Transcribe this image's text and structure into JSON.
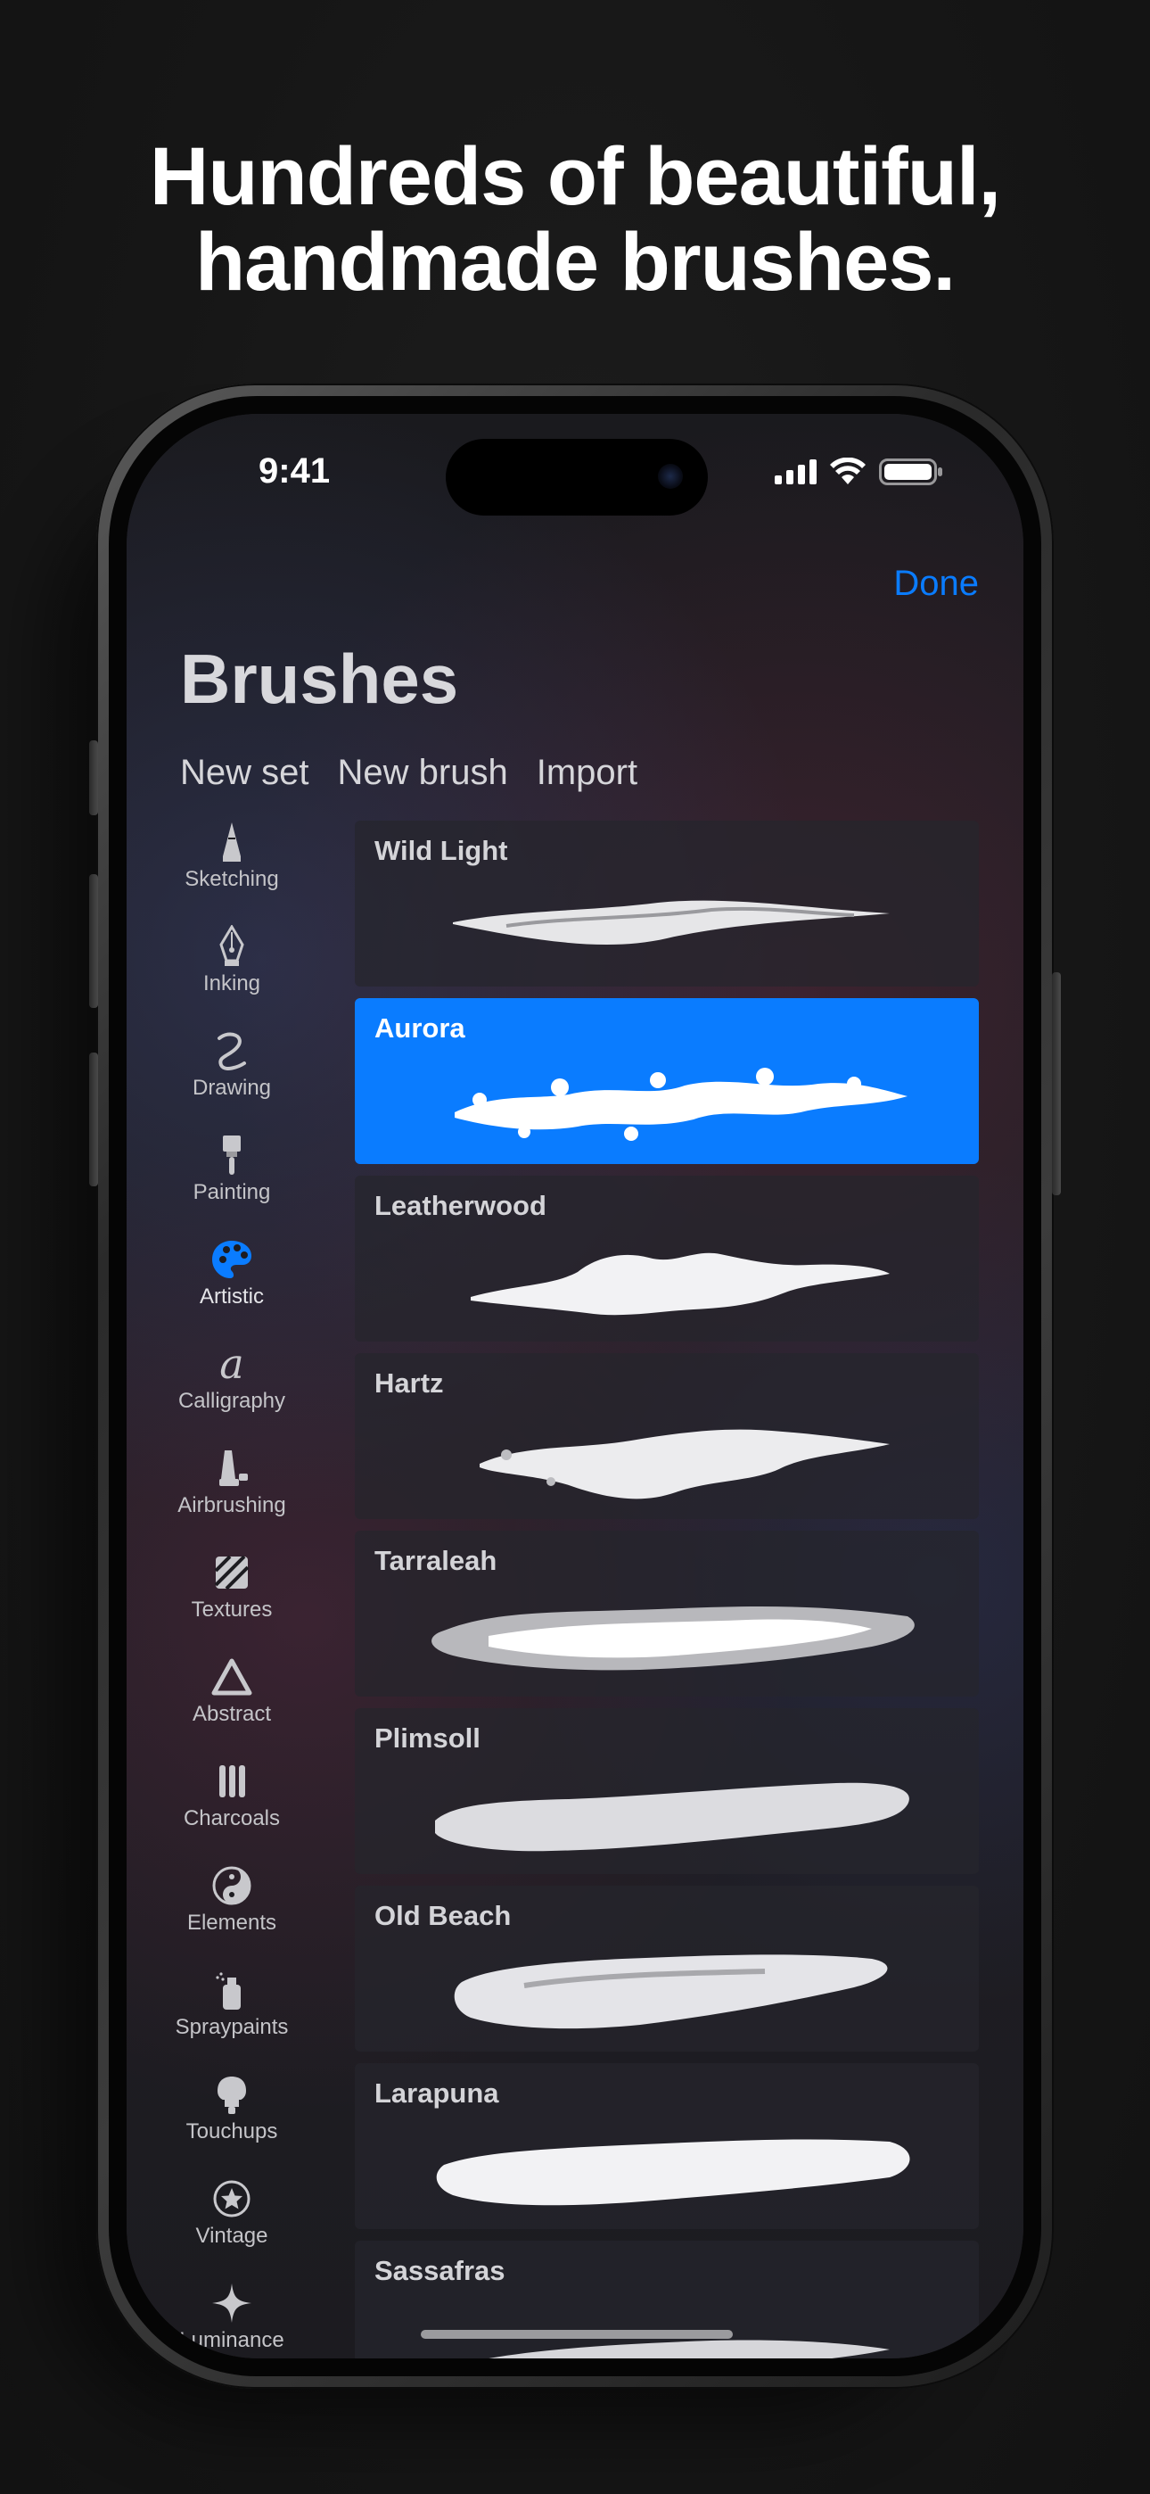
{
  "headline": {
    "line1": "Hundreds of beautiful,",
    "line2": "handmade brushes."
  },
  "status_bar": {
    "time": "9:41",
    "icons": [
      "cellular-signal-icon",
      "wifi-icon",
      "battery-icon"
    ]
  },
  "header": {
    "done_label": "Done",
    "title": "Brushes",
    "actions": [
      "New set",
      "New brush",
      "Import"
    ]
  },
  "categories": [
    {
      "label": "Sketching",
      "icon": "pencil-tip-icon",
      "active": false
    },
    {
      "label": "Inking",
      "icon": "pen-nib-icon",
      "active": false
    },
    {
      "label": "Drawing",
      "icon": "squiggle-icon",
      "active": false
    },
    {
      "label": "Painting",
      "icon": "paintbrush-icon",
      "active": false
    },
    {
      "label": "Artistic",
      "icon": "palette-icon",
      "active": true
    },
    {
      "label": "Calligraphy",
      "icon": "calligraphy-a-icon",
      "active": false
    },
    {
      "label": "Airbrushing",
      "icon": "airbrush-icon",
      "active": false
    },
    {
      "label": "Textures",
      "icon": "textures-icon",
      "active": false
    },
    {
      "label": "Abstract",
      "icon": "triangle-icon",
      "active": false
    },
    {
      "label": "Charcoals",
      "icon": "charcoal-sticks-icon",
      "active": false
    },
    {
      "label": "Elements",
      "icon": "yin-yang-icon",
      "active": false
    },
    {
      "label": "Spraypaints",
      "icon": "spray-can-icon",
      "active": false
    },
    {
      "label": "Touchups",
      "icon": "touchup-icon",
      "active": false
    },
    {
      "label": "Vintage",
      "icon": "star-badge-icon",
      "active": false
    },
    {
      "label": "Luminance",
      "icon": "sparkle-icon",
      "active": false
    }
  ],
  "brushes": [
    {
      "name": "Wild Light",
      "selected": false
    },
    {
      "name": "Aurora",
      "selected": true
    },
    {
      "name": "Leatherwood",
      "selected": false
    },
    {
      "name": "Hartz",
      "selected": false
    },
    {
      "name": "Tarraleah",
      "selected": false
    },
    {
      "name": "Plimsoll",
      "selected": false
    },
    {
      "name": "Old Beach",
      "selected": false
    },
    {
      "name": "Larapuna",
      "selected": false
    },
    {
      "name": "Sassafras",
      "selected": false
    }
  ],
  "colors": {
    "accent": "#0a7cff",
    "page_background": "#161616",
    "screen_background": "#1d1c21"
  }
}
